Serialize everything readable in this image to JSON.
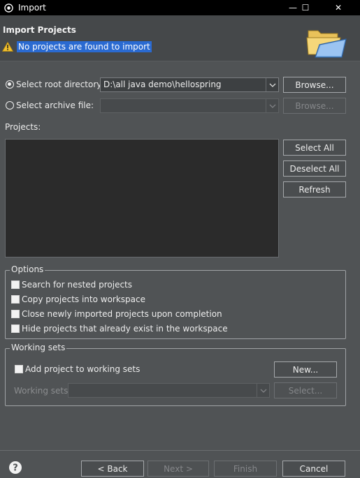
{
  "window": {
    "title": "Import",
    "controls": {
      "minimize": "—",
      "maximize": "☐",
      "close": "✕"
    }
  },
  "banner": {
    "heading": "Import Projects",
    "message": "No projects are found to import",
    "icons": {
      "warning": "warning-icon",
      "wizard": "folder-icon"
    }
  },
  "source": {
    "root_label": "Select root directory:",
    "root_value": "D:\\all java demo\\hellospring",
    "root_selected": true,
    "archive_label": "Select archive file:",
    "archive_value": "",
    "archive_selected": false,
    "browse_label": "Browse...",
    "browse_archive_label": "Browse..."
  },
  "projects": {
    "label": "Projects:",
    "items": [],
    "select_all": "Select All",
    "deselect_all": "Deselect All",
    "refresh": "Refresh"
  },
  "options": {
    "legend": "Options",
    "items": [
      {
        "label": "Search for nested projects",
        "checked": false
      },
      {
        "label": "Copy projects into workspace",
        "checked": false
      },
      {
        "label": "Close newly imported projects upon completion",
        "checked": false
      },
      {
        "label": "Hide projects that already exist in the workspace",
        "checked": false
      }
    ]
  },
  "working_sets": {
    "legend": "Working sets",
    "add_label": "Add project to working sets",
    "add_checked": false,
    "new_button": "New...",
    "sets_label": "Working sets:",
    "sets_value": "",
    "select_button": "Select..."
  },
  "footer": {
    "back": "< Back",
    "next": "Next >",
    "finish": "Finish",
    "cancel": "Cancel"
  },
  "colors": {
    "background": "#505355",
    "selection": "#2a6ad1",
    "list_bg": "#2b2b2b"
  }
}
